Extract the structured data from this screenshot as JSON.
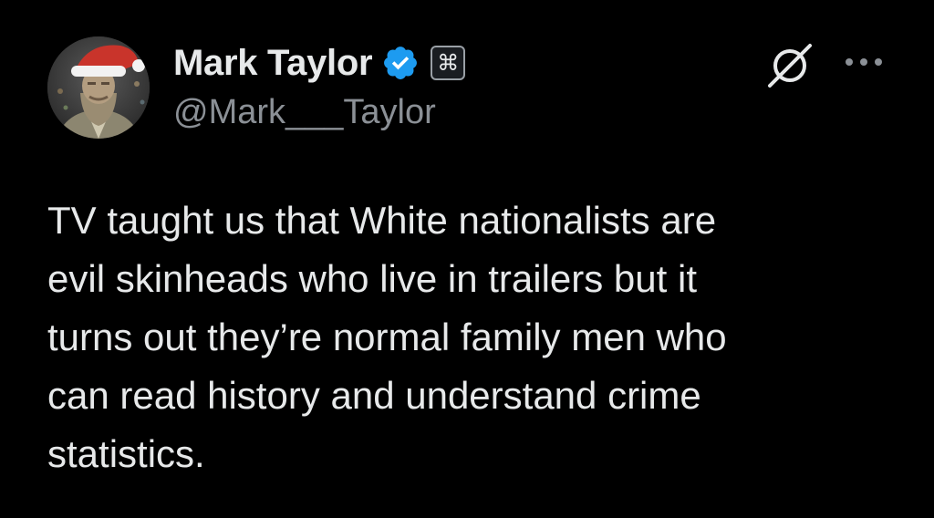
{
  "tweet": {
    "author": {
      "display_name": "Mark Taylor",
      "handle": "@Mark___Taylor",
      "verified": true,
      "verified_color": "#1d9bf0",
      "affiliate_badge_glyph": "⌘"
    },
    "text": "TV taught us that White nationalists are\nevil skinheads who live in trailers but it\nturns out they’re normal family men who\ncan read history and understand crime\nstatistics.",
    "actions": {
      "grok_icon": "grok-icon",
      "more_icon": "more-icon"
    }
  },
  "theme": {
    "background": "#000000",
    "primary_text": "#e7e9ea",
    "secondary_text": "#8b9096"
  }
}
